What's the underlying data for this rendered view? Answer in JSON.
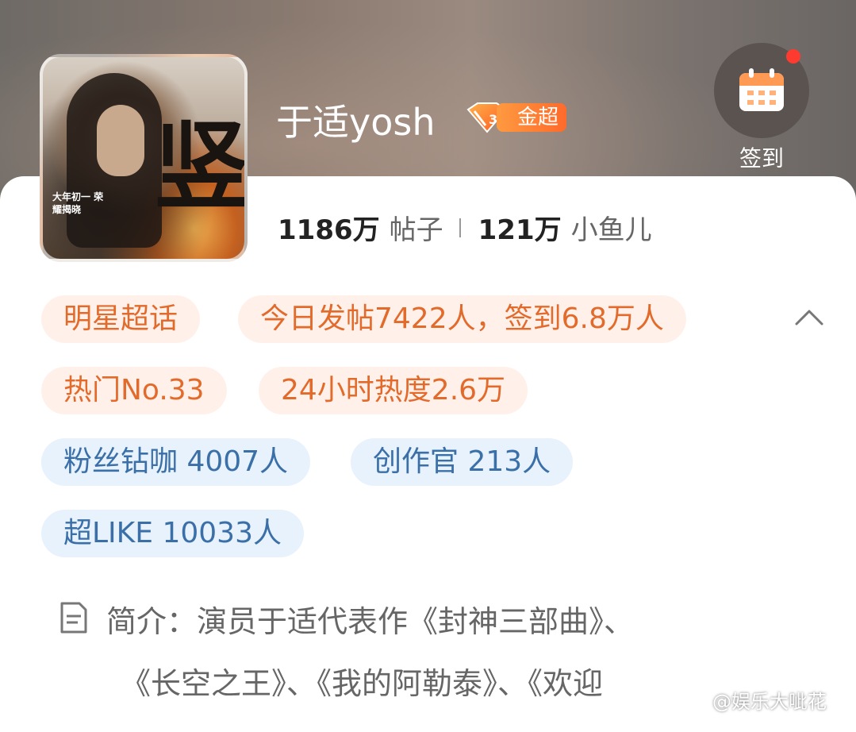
{
  "profile": {
    "username": "于适yosh",
    "badge_level": "3",
    "badge_label": "金超",
    "avatar_char": "竖",
    "avatar_caption": "大年初一 荣耀揭晓"
  },
  "signin": {
    "label": "签到",
    "icon": "calendar-icon",
    "has_notification": true
  },
  "stats": {
    "posts_count": "1186万",
    "posts_label": "帖子",
    "fans_count": "121万",
    "fans_label": "小鱼儿"
  },
  "chips": {
    "category": "明星超话",
    "today": "今日发帖7422人，签到6.8万人",
    "rank": "热门No.33",
    "heat": "24小时热度2.6万",
    "fans_vip": "粉丝钻咖 4007人",
    "creators": "创作官 213人",
    "super_like": "超LIKE 10033人"
  },
  "intro": {
    "line1": "简介：演员于适代表作《封神三部曲》、",
    "line2": "《长空之王》、《我的阿勒泰》、《欢迎"
  },
  "watermark": {
    "text": "@娱乐大呲花"
  },
  "colors": {
    "orange_chip_bg": "#fff1ea",
    "orange_chip_text": "#e26a2a",
    "blue_chip_bg": "#e7f2fc",
    "blue_chip_text": "#3a6fa8",
    "badge": "#ff6a2a",
    "notification_dot": "#ff3b30"
  }
}
